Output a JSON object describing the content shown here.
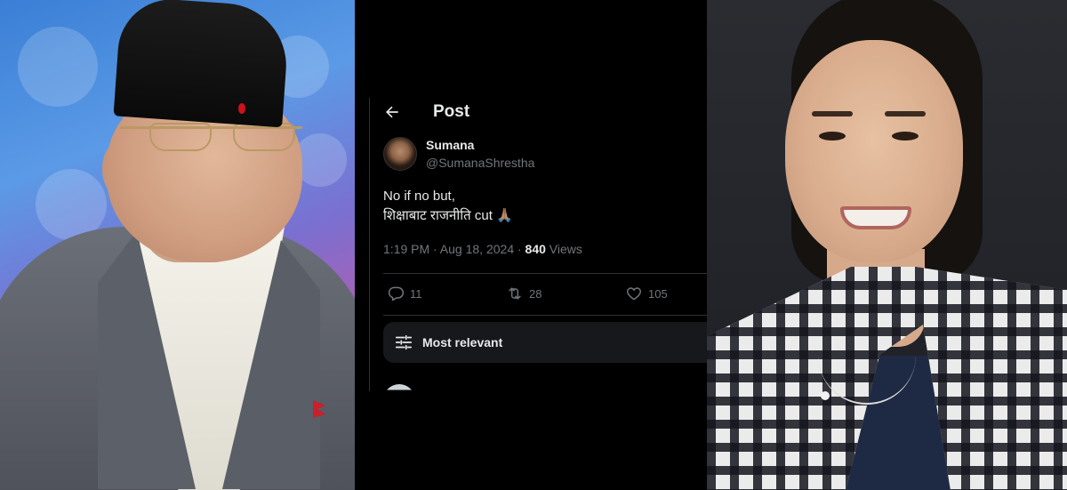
{
  "header": {
    "back_icon": "arrow-left-icon",
    "title": "Post"
  },
  "post": {
    "author_name": "Sumana",
    "author_handle": "@SumanaShrestha",
    "text": "No if no but,\nशिक्षाबाट राजनीति cut 🙏🏽",
    "time": "1:19 PM · Aug 18, 2024 · ",
    "views_count": "840",
    "views_label": " Views"
  },
  "actions": {
    "replies": "11",
    "reposts": "28",
    "likes": "105"
  },
  "sort": {
    "icon": "sliders-icon",
    "label": "Most relevant"
  },
  "colors": {
    "background": "#000000",
    "text_primary": "#e7e9ea",
    "text_secondary": "#71767b",
    "divider": "#2f3336",
    "sort_bar": "#16181c"
  }
}
